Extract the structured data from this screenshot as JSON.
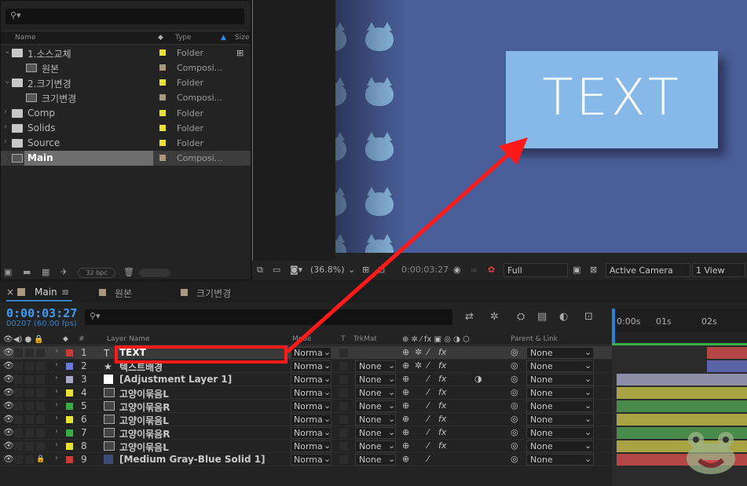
{
  "project": {
    "columns": {
      "name": "Name",
      "type": "Type",
      "size": "Size"
    },
    "items": [
      {
        "name": "1.소스교체",
        "type": "Folder",
        "icon": "folder-icon",
        "label_color": "#e8e035",
        "expanded": true
      },
      {
        "name": "원본",
        "type": "Composi...",
        "icon": "composition-icon",
        "label_color": "#a89a80"
      },
      {
        "name": "2.크기변경",
        "type": "Folder",
        "icon": "folder-icon",
        "label_color": "#e8e035",
        "expanded": true
      },
      {
        "name": "크기변경",
        "type": "Composi...",
        "icon": "composition-icon",
        "label_color": "#a89a80"
      },
      {
        "name": "Comp",
        "type": "Folder",
        "icon": "folder-icon",
        "label_color": "#e8e035"
      },
      {
        "name": "Solids",
        "type": "Folder",
        "icon": "folder-icon",
        "label_color": "#e8e035"
      },
      {
        "name": "Source",
        "type": "Folder",
        "icon": "folder-icon",
        "label_color": "#e8e035"
      },
      {
        "name": "Main",
        "type": "Composi...",
        "icon": "composition-icon",
        "label_color": "#a89a80",
        "selected": true
      }
    ],
    "bpc": "32 bpc"
  },
  "viewer": {
    "preview_text": "TEXT",
    "zoom": "(36.8%)",
    "timecode": "0:00:03:27",
    "resolution": "Full",
    "camera": "Active Camera",
    "views": "1 View"
  },
  "tabs": [
    {
      "label": "Main",
      "active": true
    },
    {
      "label": "원본",
      "color": "#a89a80"
    },
    {
      "label": "크기변경",
      "color": "#a89a80"
    }
  ],
  "timeline": {
    "timecode": "0:00:03:27",
    "frames": "00207 (60.00 fps)",
    "headers": {
      "layer_name": "Layer Name",
      "mode": "Mode",
      "t": "T",
      "trkmat": "TrkMat",
      "parent": "Parent & Link"
    },
    "ruler": [
      "0:00s",
      "01s",
      "02s"
    ],
    "layers": [
      {
        "num": "1",
        "name": "TEXT",
        "type": "text",
        "label_color": "#c83c3c",
        "mode": "Norma",
        "trkmat": "",
        "parent": "None",
        "bar_color": "#b54646"
      },
      {
        "num": "2",
        "name": "텍스트배경",
        "type": "shape",
        "label_color": "#6a7ad8",
        "mode": "Norma",
        "trkmat": "None",
        "parent": "None",
        "bar_color": "#5a63a8"
      },
      {
        "num": "3",
        "name": "[Adjustment Layer 1]",
        "type": "adjustment",
        "label_color": "#a7a7c8",
        "mode": "Norma",
        "trkmat": "None",
        "parent": "None",
        "bar_color": "#8e8ea8"
      },
      {
        "num": "4",
        "name": "고양이묶음L",
        "type": "comp",
        "label_color": "#e8e035",
        "mode": "Norma",
        "trkmat": "None",
        "parent": "None",
        "bar_color": "#a8a444"
      },
      {
        "num": "5",
        "name": "고양이묶음R",
        "type": "comp",
        "label_color": "#3ca84a",
        "mode": "Norma",
        "trkmat": "None",
        "parent": "None",
        "bar_color": "#4a8a4a"
      },
      {
        "num": "6",
        "name": "고양이묶음L",
        "type": "comp",
        "label_color": "#e8e035",
        "mode": "Norma",
        "trkmat": "None",
        "parent": "None",
        "bar_color": "#a8a444"
      },
      {
        "num": "7",
        "name": "고양이묶음R",
        "type": "comp",
        "label_color": "#3ca84a",
        "mode": "Norma",
        "trkmat": "None",
        "parent": "None",
        "bar_color": "#4a8a4a"
      },
      {
        "num": "8",
        "name": "고양이묶음L",
        "type": "comp",
        "label_color": "#e8e035",
        "mode": "Norma",
        "trkmat": "None",
        "parent": "None",
        "bar_color": "#a8a444"
      },
      {
        "num": "9",
        "name": "[Medium Gray-Blue Solid 1]",
        "type": "solid",
        "label_color": "#c83c3c",
        "mode": "Norma",
        "trkmat": "None",
        "parent": "None",
        "bar_color": "#b54646",
        "locked": true
      }
    ]
  }
}
